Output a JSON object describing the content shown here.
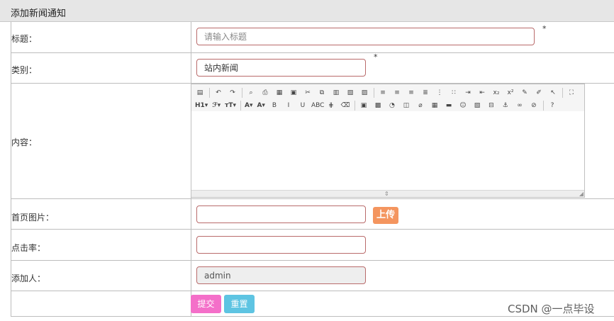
{
  "header": {
    "title": "添加新闻通知"
  },
  "form": {
    "title": {
      "label": "标题：",
      "placeholder": "请输入标题",
      "value": "",
      "required_mark": "*"
    },
    "category": {
      "label": "类别：",
      "value": "站内新闻",
      "required_mark": "*"
    },
    "content": {
      "label": "内容："
    },
    "image": {
      "label": "首页图片：",
      "value": "",
      "upload_label": "上传"
    },
    "clicks": {
      "label": "点击率：",
      "value": ""
    },
    "author": {
      "label": "添加人：",
      "value": "admin"
    }
  },
  "editor": {
    "toolbar_row1": [
      {
        "name": "source-icon",
        "glyph": "▤"
      },
      {
        "sep": true
      },
      {
        "name": "undo-icon",
        "glyph": "↶"
      },
      {
        "name": "redo-icon",
        "glyph": "↷"
      },
      {
        "sep": true
      },
      {
        "name": "preview-icon",
        "glyph": "⌕"
      },
      {
        "name": "print-icon",
        "glyph": "⎙"
      },
      {
        "name": "template-icon",
        "glyph": "▦"
      },
      {
        "name": "code-icon",
        "glyph": "▣"
      },
      {
        "name": "cut-icon",
        "glyph": "✂"
      },
      {
        "name": "copy-icon",
        "glyph": "⧉"
      },
      {
        "name": "paste-icon",
        "glyph": "▥"
      },
      {
        "name": "paste-text-icon",
        "glyph": "▧"
      },
      {
        "name": "paste-word-icon",
        "glyph": "▨"
      },
      {
        "sep": true
      },
      {
        "name": "align-left-icon",
        "glyph": "≡"
      },
      {
        "name": "align-center-icon",
        "glyph": "≡"
      },
      {
        "name": "align-right-icon",
        "glyph": "≡"
      },
      {
        "name": "align-justify-icon",
        "glyph": "≣"
      },
      {
        "name": "ordered-list-icon",
        "glyph": "⋮"
      },
      {
        "name": "unordered-list-icon",
        "glyph": "∷"
      },
      {
        "name": "indent-icon",
        "glyph": "⇥"
      },
      {
        "name": "outdent-icon",
        "glyph": "⇤"
      },
      {
        "name": "subscript-icon",
        "glyph": "x₂"
      },
      {
        "name": "superscript-icon",
        "glyph": "x²"
      },
      {
        "name": "clear-format-icon",
        "glyph": "✎"
      },
      {
        "name": "format-painter-icon",
        "glyph": "✐"
      },
      {
        "name": "select-all-icon",
        "glyph": "↖"
      },
      {
        "sep": true
      },
      {
        "name": "fullscreen-icon",
        "glyph": "⛶"
      }
    ],
    "toolbar_row2": [
      {
        "name": "heading-icon",
        "glyph": "H1▾",
        "txt": true
      },
      {
        "name": "font-family-icon",
        "glyph": "ℱ▾",
        "txt": true
      },
      {
        "name": "font-size-icon",
        "glyph": "ᴛT▾",
        "txt": true
      },
      {
        "sep": true
      },
      {
        "name": "font-color-icon",
        "glyph": "A▾",
        "txt": true
      },
      {
        "name": "highlight-icon",
        "glyph": "A▾",
        "txt": true
      },
      {
        "name": "bold-icon",
        "glyph": "B"
      },
      {
        "name": "italic-icon",
        "glyph": "I"
      },
      {
        "name": "underline-icon",
        "glyph": "U"
      },
      {
        "name": "strikethrough-icon",
        "glyph": "ABC"
      },
      {
        "name": "line-height-icon",
        "glyph": "⋕"
      },
      {
        "name": "eraser-icon",
        "glyph": "⌫"
      },
      {
        "sep": true
      },
      {
        "name": "image-icon",
        "glyph": "▣"
      },
      {
        "name": "multi-image-icon",
        "glyph": "▩"
      },
      {
        "name": "flash-icon",
        "glyph": "◔"
      },
      {
        "name": "media-icon",
        "glyph": "◫"
      },
      {
        "name": "attachment-icon",
        "glyph": "⌀"
      },
      {
        "name": "table-icon",
        "glyph": "▦"
      },
      {
        "name": "hr-icon",
        "glyph": "▬"
      },
      {
        "name": "emoticon-icon",
        "glyph": "☺"
      },
      {
        "name": "map-icon",
        "glyph": "▧"
      },
      {
        "name": "pagebreak-icon",
        "glyph": "⊟"
      },
      {
        "name": "anchor-icon",
        "glyph": "⚓"
      },
      {
        "name": "link-icon",
        "glyph": "∞"
      },
      {
        "name": "unlink-icon",
        "glyph": "⊘"
      },
      {
        "sep": true
      },
      {
        "name": "help-icon",
        "glyph": "?"
      }
    ]
  },
  "buttons": {
    "submit": "提交",
    "reset": "重置"
  },
  "watermark": "CSDN @一点毕设"
}
